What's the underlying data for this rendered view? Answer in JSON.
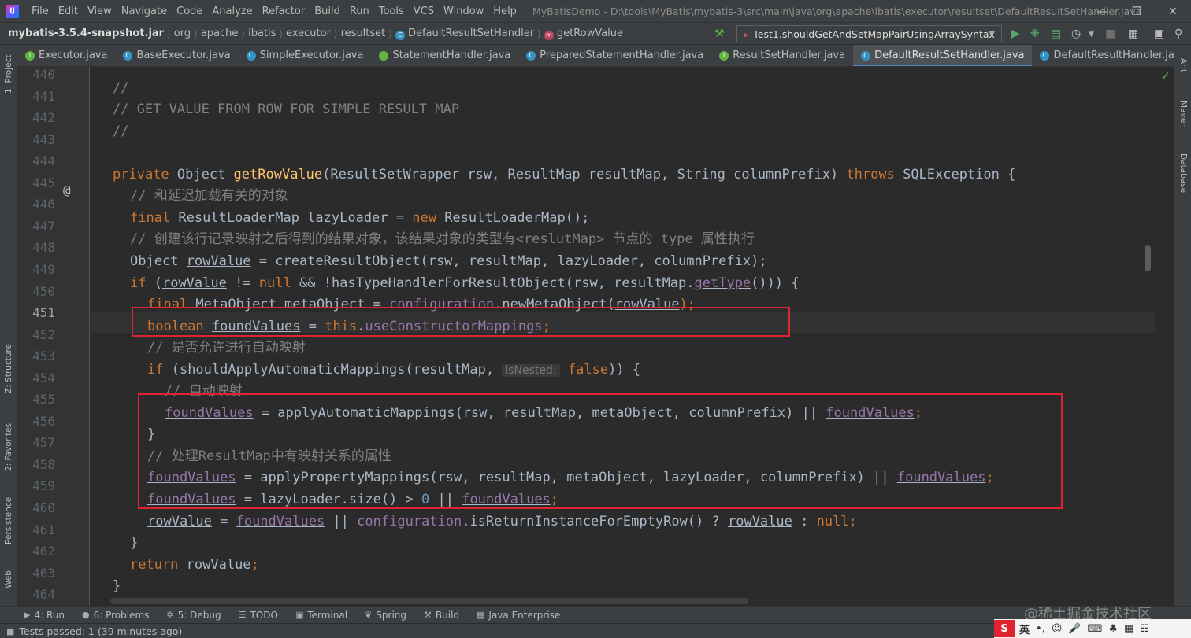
{
  "menubar": {
    "logo": "IJ",
    "items": [
      "File",
      "Edit",
      "View",
      "Navigate",
      "Code",
      "Analyze",
      "Refactor",
      "Build",
      "Run",
      "Tools",
      "VCS",
      "Window",
      "Help"
    ],
    "title": "MyBatisDemo - D:\\tools\\MyBatis\\mybatis-3\\src\\main\\java\\org\\apache\\ibatis\\executor\\resultset\\DefaultResultSetHandler.java"
  },
  "navbar": {
    "crumbs": [
      "mybatis-3.5.4-snapshot.jar",
      "org",
      "apache",
      "ibatis",
      "executor",
      "resultset",
      "DefaultResultSetHandler",
      "getRowValue"
    ],
    "run_config": "Test1.shouldGetAndSetMapPairUsingArraySyntax"
  },
  "tabs": [
    {
      "label": "Executor.java",
      "icon": "interface-icon",
      "color": "#62b543"
    },
    {
      "label": "BaseExecutor.java",
      "icon": "abstract-class-icon",
      "color": "#3592c4"
    },
    {
      "label": "SimpleExecutor.java",
      "icon": "class-icon",
      "color": "#3592c4"
    },
    {
      "label": "StatementHandler.java",
      "icon": "interface-icon",
      "color": "#62b543"
    },
    {
      "label": "PreparedStatementHandler.java",
      "icon": "class-icon",
      "color": "#3592c4"
    },
    {
      "label": "ResultSetHandler.java",
      "icon": "interface-icon",
      "color": "#62b543"
    },
    {
      "label": "DefaultResultSetHandler.java",
      "icon": "class-icon",
      "color": "#3592c4",
      "active": true
    },
    {
      "label": "DefaultResultHandler.java",
      "icon": "class-icon",
      "color": "#3592c4"
    }
  ],
  "left_tools": [
    "1: Project",
    "Z: Structure",
    "2: Favorites",
    "Persistence",
    "Web"
  ],
  "right_tools": [
    "Ant",
    "Maven",
    "Database"
  ],
  "gutter": {
    "lines": [
      "440",
      "441",
      "442",
      "443",
      "444",
      "445",
      "446",
      "447",
      "448",
      "449",
      "450",
      "451",
      "452",
      "453",
      "454",
      "455",
      "456",
      "457",
      "458",
      "459",
      "460",
      "461",
      "462",
      "463",
      "464"
    ],
    "override_marker": "@"
  },
  "code": {
    "l441": "//",
    "l442": "// GET VALUE FROM ROW FOR SIMPLE RESULT MAP",
    "l443": "//",
    "l445": [
      "private ",
      "Object ",
      "getRowValue",
      "(ResultSetWrapper rsw, ResultMap resultMap, String columnPrefix) ",
      "throws ",
      "SQLException {"
    ],
    "l446": "// 和延迟加载有关的对象",
    "l447": [
      "final ",
      "ResultLoaderMap lazyLoader = ",
      "new ",
      "ResultLoaderMap();"
    ],
    "l448": "// 创建该行记录映射之后得到的结果对象，该结果对象的类型有<reslutMap> 节点的 type 属性执行",
    "l449": [
      "Object ",
      "rowValue",
      " = createResultObject(rsw, resultMap, lazyLoader, columnPrefix);"
    ],
    "l450": [
      "if ",
      "(",
      "rowValue",
      " != ",
      "null",
      " && !hasTypeHandlerForResultObject(rsw, resultMap.",
      "getType",
      "())) {"
    ],
    "l451": [
      "final ",
      "MetaObject metaObject = ",
      "configuration",
      ".newMetaObject(",
      "rowValue",
      ");"
    ],
    "l452": [
      "boolean ",
      "foundValues",
      " = ",
      "this",
      ".",
      "useConstructorMappings",
      ";"
    ],
    "l453": "// 是否允许进行自动映射",
    "l454": [
      "if ",
      "(shouldApplyAutomaticMappings(resultMap, ",
      "isNested:",
      " false",
      ")) {"
    ],
    "l455": "// 自动映射",
    "l456": [
      "foundValues",
      " = applyAutomaticMappings(rsw, resultMap, metaObject, columnPrefix) || ",
      "foundValues",
      ";"
    ],
    "l457": "}",
    "l458": "// 处理ResultMap中有映射关系的属性",
    "l459": [
      "foundValues",
      " = applyPropertyMappings(rsw, resultMap, metaObject, lazyLoader, columnPrefix) || ",
      "foundValues",
      ";"
    ],
    "l460": [
      "foundValues",
      " = lazyLoader.size() > ",
      "0",
      " || ",
      "foundValues",
      ";"
    ],
    "l461": [
      "rowValue",
      " = ",
      "foundValues",
      " || ",
      "configuration",
      ".isReturnInstanceForEmptyRow() ? ",
      "rowValue",
      " : ",
      "null",
      ";"
    ],
    "l462": "}",
    "l463": [
      "return ",
      "rowValue",
      ";"
    ],
    "l464": "}"
  },
  "bottom_tools": [
    {
      "label": "4: Run",
      "icon": "run-icon"
    },
    {
      "label": "6: Problems",
      "icon": "problems-icon"
    },
    {
      "label": "5: Debug",
      "icon": "debug-icon"
    },
    {
      "label": "TODO",
      "icon": "todo-icon"
    },
    {
      "label": "Terminal",
      "icon": "terminal-icon"
    },
    {
      "label": "Spring",
      "icon": "spring-icon"
    },
    {
      "label": "Build",
      "icon": "build-icon"
    },
    {
      "label": "Java Enterprise",
      "icon": "java-enterprise-icon"
    }
  ],
  "status": {
    "text": "Tests passed: 1 (39 minutes ago)"
  },
  "watermark": "@稀土掘金技术社区",
  "ime": {
    "lang": "英"
  },
  "colors": {
    "keyword": "#cc7832",
    "comment": "#808080",
    "method": "#ffc66d",
    "field": "#9876aa",
    "number": "#6897bb",
    "highlight_box": "#e0242f"
  }
}
